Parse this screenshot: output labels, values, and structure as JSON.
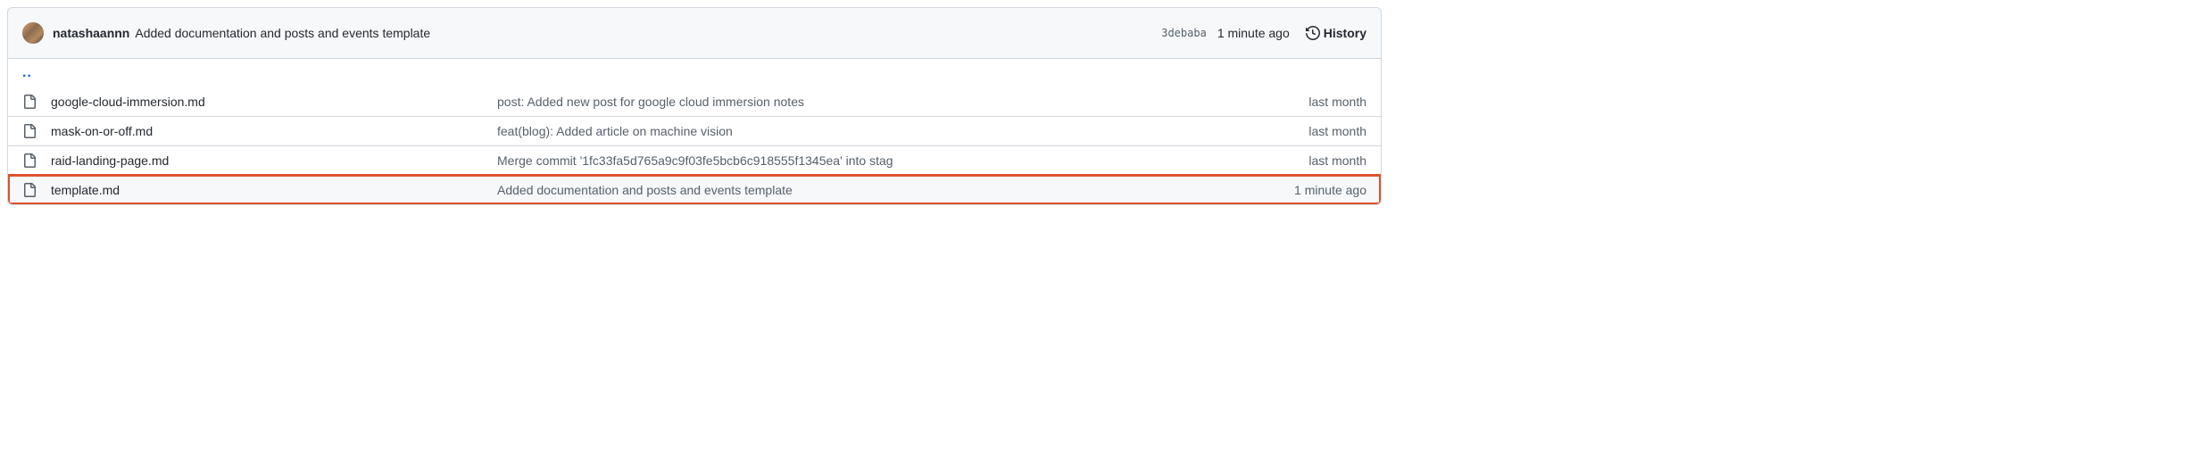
{
  "header": {
    "author": "natashaannn",
    "commit_message": "Added documentation and posts and events template",
    "sha_short": "3debaba",
    "time": "1 minute ago",
    "history_label": "History"
  },
  "updir_label": "..",
  "files": [
    {
      "name": "google-cloud-immersion.md",
      "message": "post: Added new post for google cloud immersion notes",
      "time": "last month",
      "highlighted": false
    },
    {
      "name": "mask-on-or-off.md",
      "message": "feat(blog): Added article on machine vision",
      "time": "last month",
      "highlighted": false
    },
    {
      "name": "raid-landing-page.md",
      "message": "Merge commit '1fc33fa5d765a9c9f03fe5bcb6c918555f1345ea' into stag",
      "time": "last month",
      "highlighted": false
    },
    {
      "name": "template.md",
      "message": "Added documentation and posts and events template",
      "time": "1 minute ago",
      "highlighted": true
    }
  ]
}
